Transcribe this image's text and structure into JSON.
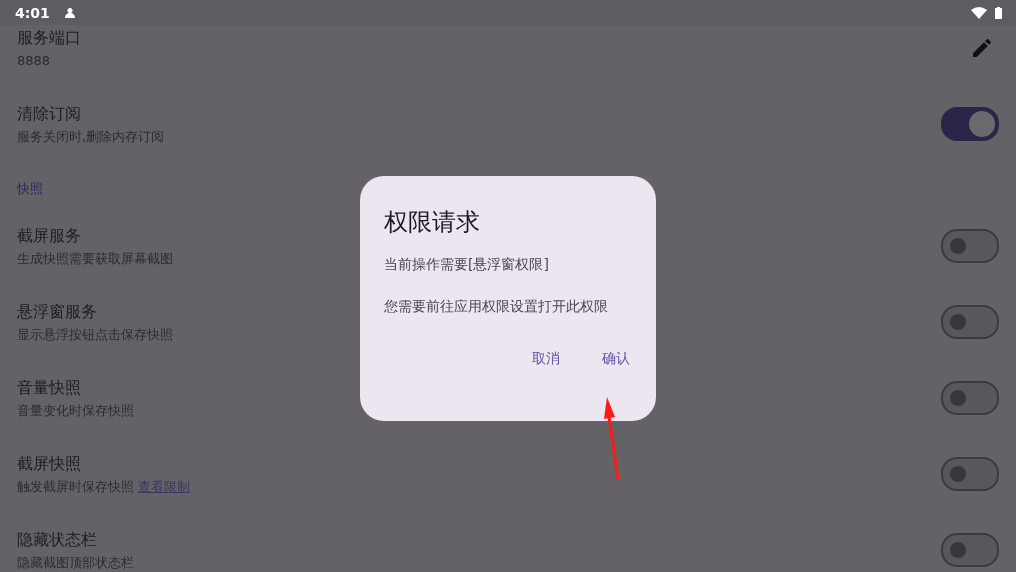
{
  "status_bar": {
    "time": "4:01"
  },
  "settings": [
    {
      "kind": "edit",
      "title": "服务端口",
      "subtitle": "8888"
    },
    {
      "kind": "switch",
      "title": "清除订阅",
      "subtitle": "服务关闭时,删除内存订阅",
      "on": true
    },
    {
      "kind": "header",
      "title": "快照"
    },
    {
      "kind": "switch",
      "title": "截屏服务",
      "subtitle": "生成快照需要获取屏幕截图",
      "on": false
    },
    {
      "kind": "switch",
      "title": "悬浮窗服务",
      "subtitle": "显示悬浮按钮点击保存快照",
      "on": false
    },
    {
      "kind": "switch",
      "title": "音量快照",
      "subtitle": "音量变化时保存快照",
      "on": false
    },
    {
      "kind": "switch",
      "title": "截屏快照",
      "subtitle": "触发截屏时保存快照",
      "link": "查看限制",
      "on": false
    },
    {
      "kind": "switch",
      "title": "隐藏状态栏",
      "subtitle": "隐藏截图顶部状态栏",
      "on": false
    }
  ],
  "dialog": {
    "title": "权限请求",
    "lines": [
      "当前操作需要[悬浮窗权限]",
      "您需要前往应用权限设置打开此权限"
    ],
    "buttons": [
      "取消",
      "确认"
    ]
  },
  "annotations": [
    {
      "kind": "arrow",
      "color": "#ff1a1a"
    }
  ]
}
